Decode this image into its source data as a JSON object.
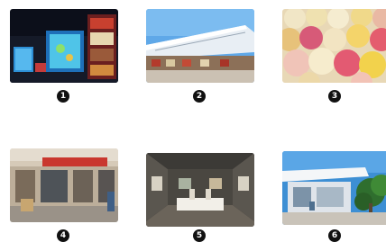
{
  "thumbnails": [
    {
      "number": "1",
      "icon": "aquarium-shop-night-image"
    },
    {
      "number": "2",
      "icon": "canopy-market-building-image"
    },
    {
      "number": "3",
      "icon": "colorful-gelato-balls-image"
    },
    {
      "number": "4",
      "icon": "shopfront-street-image"
    },
    {
      "number": "5",
      "icon": "gallery-interior-image"
    },
    {
      "number": "6",
      "icon": "modern-pavilion-tree-image"
    }
  ],
  "colors": {
    "badge": "#111111",
    "badge_text": "#ffffff"
  }
}
